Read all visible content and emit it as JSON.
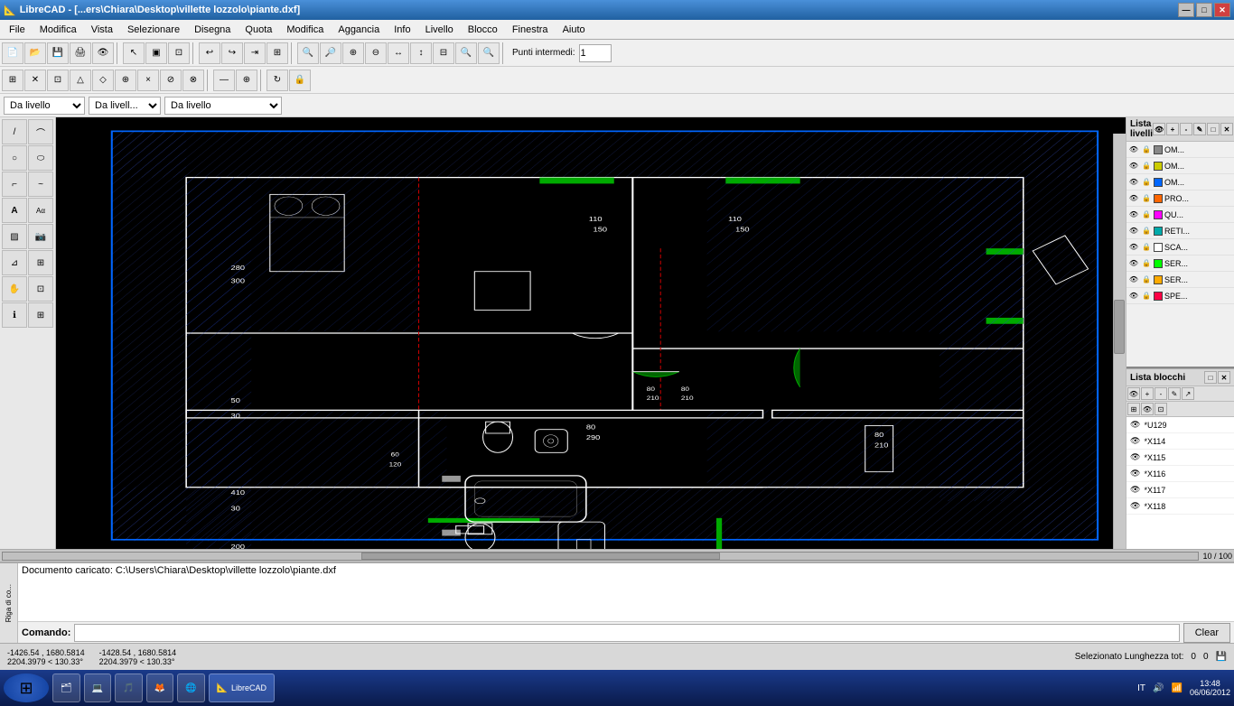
{
  "titlebar": {
    "title": "LibreCAD - [...ers\\Chiara\\Desktop\\villette lozzolo\\piante.dxf]",
    "icon": "📐",
    "min_label": "—",
    "max_label": "□",
    "close_label": "✕"
  },
  "menubar": {
    "items": [
      "File",
      "Modifica",
      "Vista",
      "Selezionare",
      "Disegna",
      "Quota",
      "Modifica",
      "Aggancia",
      "Info",
      "Livello",
      "Blocco",
      "Finestra",
      "Aiuto"
    ]
  },
  "snap_toolbar": {
    "label": "Punti intermedi:",
    "value": "1"
  },
  "layer_toolbar": {
    "dropdown1_value": "Da livello",
    "dropdown2_value": "Da livell...",
    "dropdown3_value": "Da livello"
  },
  "layers": {
    "panel_title": "Lista livelli",
    "items": [
      {
        "name": "OM..."
      },
      {
        "name": "OM..."
      },
      {
        "name": "OM..."
      },
      {
        "name": "PRO..."
      },
      {
        "name": "QU..."
      },
      {
        "name": "RETI..."
      },
      {
        "name": "SCA..."
      },
      {
        "name": "SER..."
      },
      {
        "name": "SER..."
      },
      {
        "name": "SPE..."
      }
    ]
  },
  "blocks": {
    "panel_title": "Lista blocchi",
    "items": [
      {
        "name": "*U129"
      },
      {
        "name": "*X114"
      },
      {
        "name": "*X115"
      },
      {
        "name": "*X116"
      },
      {
        "name": "*X117"
      },
      {
        "name": "*X118"
      }
    ]
  },
  "command": {
    "tab_label": "Riga di co...",
    "log_text": "Documento caricato: C:\\Users\\Chiara\\Desktop\\villette lozzolo\\piante.dxf",
    "prompt_label": "Comando:",
    "input_value": "",
    "clear_label": "Clear"
  },
  "statusbar": {
    "coord1_line1": "-1426.54 , 1680.5814",
    "coord1_line2": "2204.3979 < 130.33°",
    "coord2_line1": "-1428.54 , 1680.5814",
    "coord2_line2": "2204.3979 < 130.33°",
    "selected_label": "Selezionato Lunghezza tot:",
    "selected_val1": "0",
    "selected_val2": "0",
    "page_info": "10 / 100"
  },
  "taskbar": {
    "start_icon": "⊞",
    "app1_icon": "🗂",
    "app2_icon": "💻",
    "app3_icon": "🎵",
    "app4_icon": "🦊",
    "app5_icon": "🌐",
    "active_app": "LibreCAD",
    "language": "IT",
    "time": "13:48",
    "date": "06/06/2012"
  }
}
